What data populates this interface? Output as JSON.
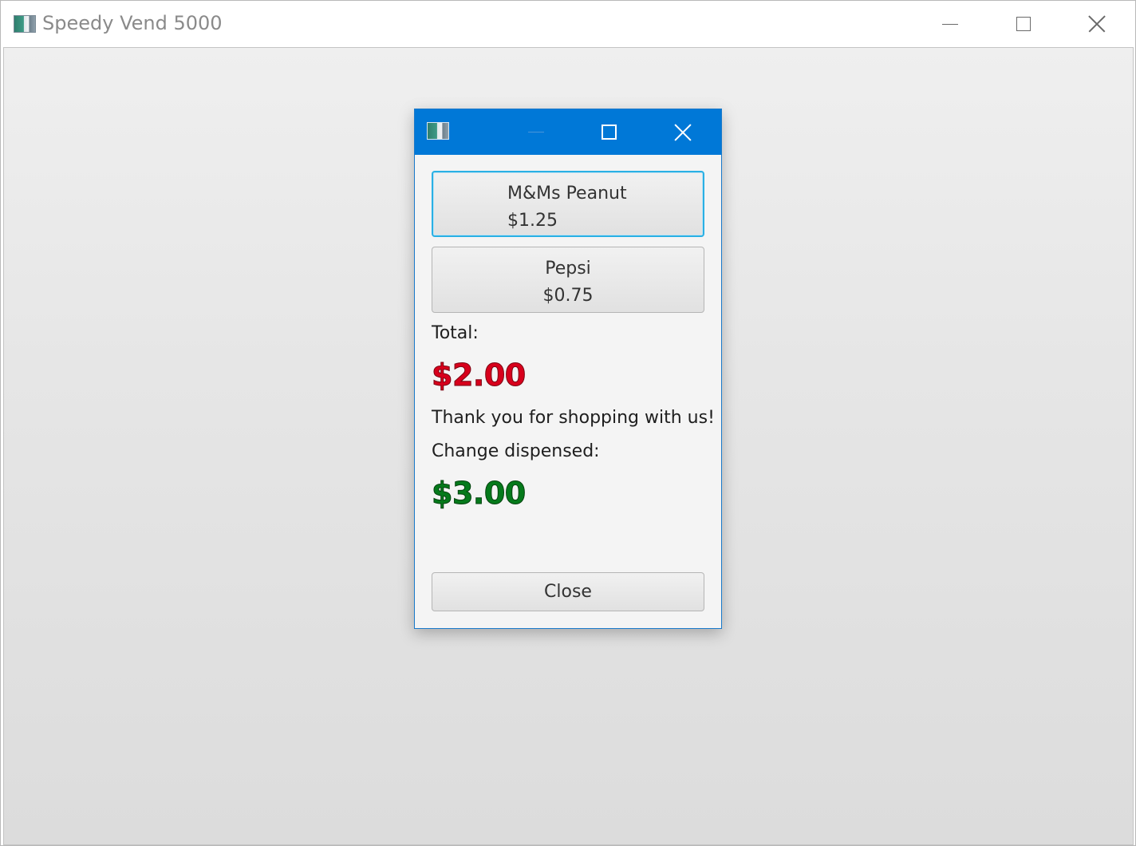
{
  "main_window": {
    "title": "Speedy Vend 5000",
    "icon": "application-icon",
    "controls": {
      "minimize": "minimize-icon",
      "maximize": "maximize-icon",
      "close": "close-icon"
    }
  },
  "dialog": {
    "icon": "application-icon",
    "controls": {
      "minimize": "minimize-icon",
      "maximize": "maximize-icon",
      "close": "close-icon"
    },
    "products": [
      {
        "name": "M&Ms Peanut",
        "price": "$1.25"
      },
      {
        "name": "Pepsi",
        "price": "$0.75"
      }
    ],
    "total_label": "Total:",
    "total_amount": "$2.00",
    "thanks_message": "Thank you for shopping with us!",
    "change_label": "Change dispensed:",
    "change_amount": "$3.00",
    "close_label": "Close"
  },
  "colors": {
    "dialog_titlebar": "#0078d7",
    "focus_ring": "#2ab0e4",
    "total_amount": "#d8001c",
    "change_amount": "#057a1b"
  }
}
